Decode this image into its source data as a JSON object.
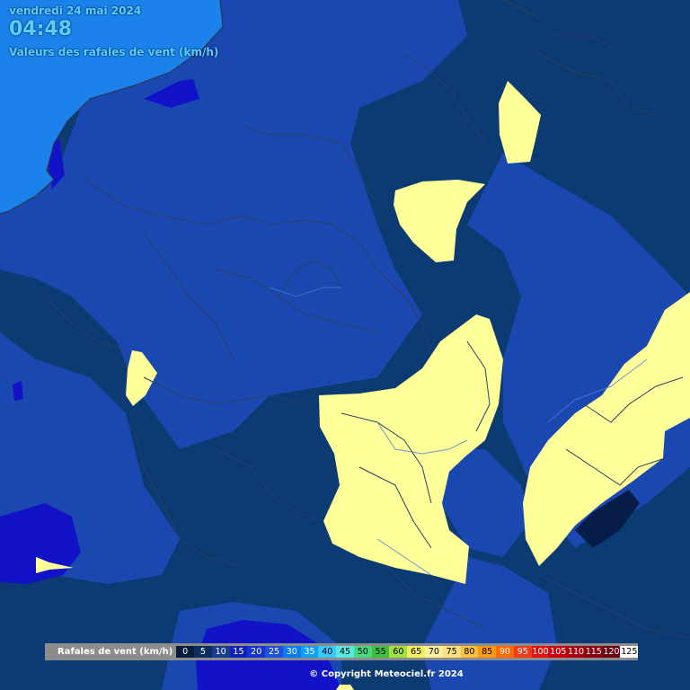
{
  "header": {
    "date": "vendredi 24 mai 2024",
    "time": "04:48",
    "subtitle": "Valeurs des rafales de vent (km/h)"
  },
  "legend": {
    "label": "Rafales de vent (km/h)",
    "items": [
      {
        "value": "0",
        "color": "#061a3c",
        "text_color": "#ffffff"
      },
      {
        "value": "5",
        "color": "#0d2e5c",
        "text_color": "#ffffff"
      },
      {
        "value": "10",
        "color": "#1b3c8a",
        "text_color": "#ffffff"
      },
      {
        "value": "15",
        "color": "#1020b8",
        "text_color": "#ffffff"
      },
      {
        "value": "20",
        "color": "#1834d0",
        "text_color": "#ffffff"
      },
      {
        "value": "25",
        "color": "#1e50d8",
        "text_color": "#ffffff"
      },
      {
        "value": "30",
        "color": "#0a7cf0",
        "text_color": "#ffffff"
      },
      {
        "value": "35",
        "color": "#10a0f8",
        "text_color": "#ffffff"
      },
      {
        "value": "40",
        "color": "#38c8ff",
        "text_color": "#000000"
      },
      {
        "value": "45",
        "color": "#58e8e0",
        "text_color": "#000000"
      },
      {
        "value": "50",
        "color": "#48d880",
        "text_color": "#000000"
      },
      {
        "value": "55",
        "color": "#40c040",
        "text_color": "#000000"
      },
      {
        "value": "60",
        "color": "#a0e040",
        "text_color": "#000000"
      },
      {
        "value": "65",
        "color": "#f0f060",
        "text_color": "#000000"
      },
      {
        "value": "70",
        "color": "#fff0a0",
        "text_color": "#000000"
      },
      {
        "value": "75",
        "color": "#ffe080",
        "text_color": "#000000"
      },
      {
        "value": "80",
        "color": "#ffc040",
        "text_color": "#000000"
      },
      {
        "value": "85",
        "color": "#ff9a10",
        "text_color": "#000000"
      },
      {
        "value": "90",
        "color": "#ff6a00",
        "text_color": "#ffffff"
      },
      {
        "value": "95",
        "color": "#f03a1a",
        "text_color": "#ffffff"
      },
      {
        "value": "100",
        "color": "#e01010",
        "text_color": "#ffffff"
      },
      {
        "value": "105",
        "color": "#c80010",
        "text_color": "#ffffff"
      },
      {
        "value": "110",
        "color": "#a80010",
        "text_color": "#ffffff"
      },
      {
        "value": "115",
        "color": "#880010",
        "text_color": "#ffffff"
      },
      {
        "value": "120",
        "color": "#680010",
        "text_color": "#ffffff"
      },
      {
        "value": "125",
        "color": "#ffffff",
        "text_color": "#000000"
      }
    ]
  },
  "map": {
    "zone_colors": {
      "sea": "#1a82ea",
      "calm": "#0c3a72",
      "light": "#113e92",
      "moderate": "#1a48b0",
      "strong": "#1212c8",
      "gust_50": "#ffff99",
      "very_calm": "#061d48"
    }
  },
  "copyright": "© Copyright Meteociel.fr 2024"
}
